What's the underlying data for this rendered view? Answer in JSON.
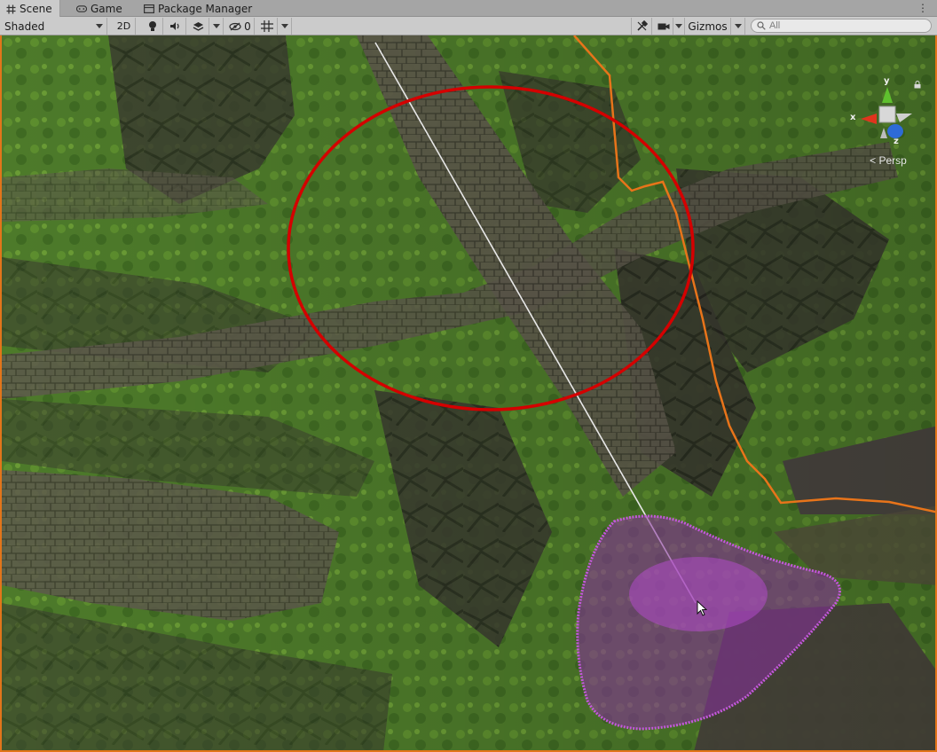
{
  "tabs": [
    {
      "label": "Scene",
      "icon": "hash-icon",
      "active": true
    },
    {
      "label": "Game",
      "icon": "gamepad-icon",
      "active": false
    },
    {
      "label": "Package Manager",
      "icon": "package-icon",
      "active": false
    }
  ],
  "toolbar": {
    "draw_mode": "Shaded",
    "mode_2d": "2D",
    "hidden_count": "0",
    "gizmos_label": "Gizmos",
    "search_placeholder": "All"
  },
  "scene": {
    "projection_label": "Persp",
    "axis_labels": {
      "x": "x",
      "y": "y",
      "z": "z"
    },
    "colors": {
      "brush_circle": "#d40000",
      "selection_outline": "#e8741a",
      "paint_area": "#a02ab8",
      "terrain_grass": "#4f7a2a"
    }
  }
}
